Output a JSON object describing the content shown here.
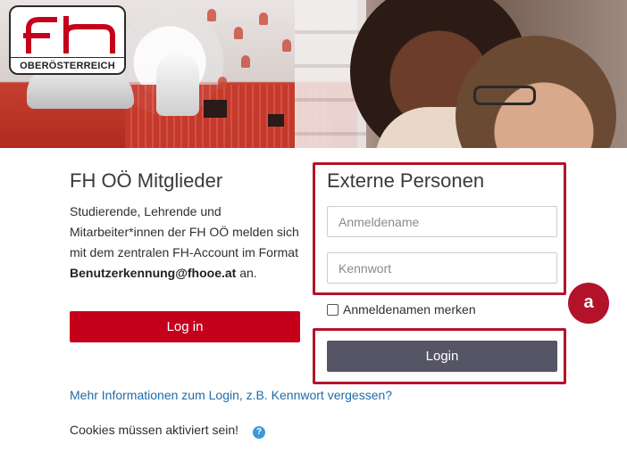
{
  "logo": {
    "mark": "fh",
    "subtitle": "OBERÖSTERREICH",
    "brand_color": "#c4001b"
  },
  "members": {
    "title": "FH OÖ Mitglieder",
    "text_prefix": "Studierende, Lehrende und Mitarbeiter*innen der FH OÖ melden sich mit dem zentralen FH-Account im Format ",
    "text_bold": "Benutzerkennung@fhooe.at",
    "text_suffix": " an.",
    "login_label": "Log in"
  },
  "external": {
    "title": "Externe Personen",
    "username_placeholder": "Anmeldename",
    "password_placeholder": "Kennwort",
    "remember_label": "Anmeldenamen merken",
    "login_label": "Login"
  },
  "annotation": {
    "marker_label": "a",
    "highlight_color": "#b3132a"
  },
  "links": {
    "more_info": "Mehr Informationen zum Login, z.B. Kennwort vergessen?"
  },
  "cookies": {
    "text": "Cookies müssen aktiviert sein!",
    "help_icon": "question-circle-icon"
  },
  "colors": {
    "primary_button": "#c4001b",
    "secondary_button": "#555566",
    "link": "#1f6aa8"
  }
}
